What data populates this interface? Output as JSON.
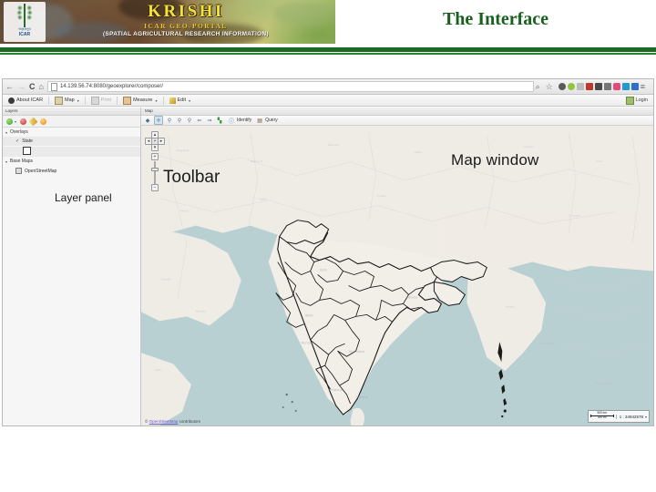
{
  "header": {
    "brand_title": "KRISHI",
    "brand_sub1": "ICAR GEO-PORTAL",
    "brand_sub2": "(SPATIAL AGRICULTURAL RESEARCH INFORMATION)",
    "logo_hindi": "भाकृअनुप",
    "logo_eng": "ICAR",
    "slide_title": "The Interface",
    "accent_green": "#1a6b21",
    "accent_yellow": "#f2e23a"
  },
  "browser": {
    "back_icon": "back-arrow",
    "forward_icon": "forward-arrow",
    "reload_icon": "C",
    "home_icon": "home",
    "url_host": "14.139.56.74",
    "url_path": ":8080/geoexplorer/composer/",
    "search_icon": "search-icon",
    "star_icon": "star-icon",
    "menu_icon": "hamburger-menu-icon"
  },
  "app_toolbar": {
    "items": [
      {
        "label": "About ICAR",
        "icon": "info-icon",
        "caret": false,
        "disabled": false
      },
      {
        "label": "Map",
        "icon": "map-icon",
        "caret": true,
        "disabled": false
      },
      {
        "label": "Print",
        "icon": "printer-icon",
        "caret": false,
        "disabled": true
      },
      {
        "label": "Measure",
        "icon": "ruler-icon",
        "caret": true,
        "disabled": false
      },
      {
        "label": "Edit",
        "icon": "pencil-icon",
        "caret": true,
        "disabled": false
      }
    ],
    "login_label": "Login",
    "login_icon": "login-icon"
  },
  "layer_panel": {
    "header": "Layers",
    "callout": "Layer panel",
    "tools": [
      {
        "name": "add-layer",
        "icon": "green-plus-icon",
        "caret": true
      },
      {
        "name": "remove-layer",
        "icon": "red-minus-icon",
        "caret": false
      },
      {
        "name": "edit-layer-style",
        "icon": "pencil-icon",
        "caret": false
      },
      {
        "name": "layer-properties",
        "icon": "orange-gear-icon",
        "caret": false
      }
    ],
    "groups": [
      {
        "label": "Overlays",
        "expanded": true,
        "layers": [
          {
            "label": "State",
            "checked": true,
            "legend": "polygon-outline-swatch"
          }
        ]
      },
      {
        "label": "Base Maps",
        "expanded": true,
        "layers": [
          {
            "label": "OpenStreetMap",
            "checked": true,
            "legend": null
          }
        ]
      }
    ]
  },
  "map": {
    "header": "Map",
    "callout": "Map window",
    "toolbar_callout": "Toolbar",
    "tools": [
      {
        "name": "layer-switcher",
        "icon": "layers-icon",
        "selected": false,
        "label": null
      },
      {
        "name": "pan-tool",
        "icon": "pan-hand-icon",
        "selected": true,
        "label": null
      },
      {
        "name": "zoom-in",
        "icon": "zoom-in-icon",
        "selected": false,
        "label": null
      },
      {
        "name": "zoom-out",
        "icon": "zoom-out-icon",
        "selected": false,
        "label": null
      },
      {
        "name": "zoom-to-extent",
        "icon": "globe-extent-icon",
        "selected": false,
        "label": null
      },
      {
        "name": "previous-extent",
        "icon": "arrow-left-icon",
        "selected": false,
        "label": null
      },
      {
        "name": "next-extent",
        "icon": "arrow-right-icon",
        "selected": false,
        "label": null
      },
      {
        "name": "zoom-to-selection",
        "icon": "grid-extent-icon",
        "selected": false,
        "label": null
      },
      {
        "name": "identify",
        "icon": "info-circle-icon",
        "selected": false,
        "label": "Identify"
      },
      {
        "name": "query",
        "icon": "query-icon",
        "selected": false,
        "label": "Query"
      }
    ],
    "nav": {
      "pan_up": "▲",
      "pan_left": "◀",
      "pan_center": "✛",
      "pan_right": "▶",
      "pan_down": "▼",
      "zoom_in": "+",
      "zoom_out": "−"
    },
    "attribution_prefix": "©",
    "attribution_link": "OpenStreetMap",
    "attribution_suffix": "contributors",
    "scale_km": "500 km",
    "scale_mi": "300 mi",
    "scale_ratio": "1 : 34942578",
    "colors": {
      "sea": "#b9d0d2",
      "land": "#efece6",
      "india_fill": "#f2efe9",
      "boundary": "#1a1a1a"
    }
  }
}
